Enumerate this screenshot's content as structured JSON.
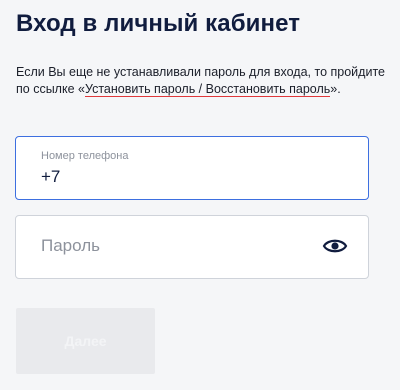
{
  "header": {
    "title": "Вход в личный кабинет"
  },
  "info": {
    "text_before": "Если Вы еще не устанавливали пароль для входа, то пройдите по ссылке «",
    "link_text": "Установить пароль / Восстановить пароль",
    "text_after": "»."
  },
  "form": {
    "phone": {
      "label": "Номер телефона",
      "value": "+7"
    },
    "password": {
      "placeholder": "Пароль",
      "toggle_icon": "eye-icon"
    },
    "submit_label": "Далее"
  },
  "colors": {
    "title": "#101c3e",
    "link_underline": "#e0383b",
    "active_border": "#3d6fe0",
    "button_disabled_bg": "#e9eaed"
  }
}
